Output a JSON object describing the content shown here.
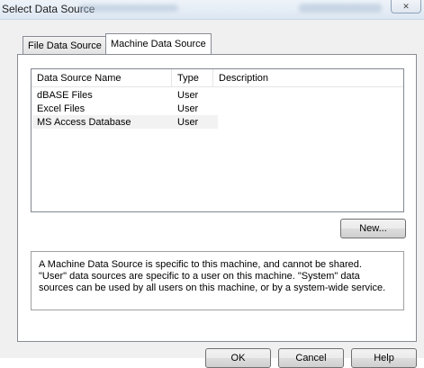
{
  "window": {
    "title": "Select Data Source",
    "close_glyph": "✕"
  },
  "tabs": [
    {
      "label": "File Data Source",
      "active": false
    },
    {
      "label": "Machine Data Source",
      "active": true
    }
  ],
  "list": {
    "columns": [
      "Data Source Name",
      "Type",
      "Description"
    ],
    "rows": [
      {
        "name": "dBASE Files",
        "type": "User",
        "description": "",
        "selected": false
      },
      {
        "name": "Excel Files",
        "type": "User",
        "description": "",
        "selected": false
      },
      {
        "name": "MS Access Database",
        "type": "User",
        "description": "",
        "selected": true
      }
    ]
  },
  "annotation": {
    "icon": "arrow-left-icon",
    "color": "#000000"
  },
  "new_button": {
    "label": "New..."
  },
  "info": {
    "lines": [
      "A Machine Data Source is specific to this machine, and cannot be shared.",
      "\"User\" data sources are specific to a user on this machine.  \"System\" data",
      "sources can be used by all users on this machine, or by a system-wide service."
    ]
  },
  "footer": {
    "ok_label": "OK",
    "cancel_label": "Cancel",
    "help_label": "Help"
  }
}
